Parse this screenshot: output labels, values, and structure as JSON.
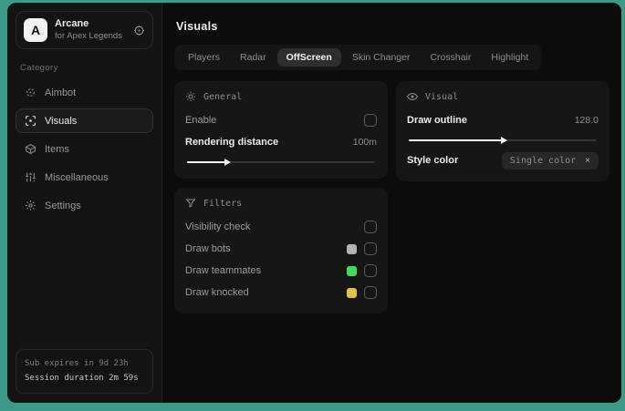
{
  "window": {
    "frame_color": "#3c9a88"
  },
  "sidebar": {
    "logo_letter": "A",
    "app_name": "Arcane",
    "app_subtitle": "for Apex Legends",
    "category_label": "Category",
    "items": [
      {
        "label": "Aimbot",
        "icon": "crosshair-icon",
        "selected": false
      },
      {
        "label": "Visuals",
        "icon": "eye-scan-icon",
        "selected": true
      },
      {
        "label": "Items",
        "icon": "box-icon",
        "selected": false
      },
      {
        "label": "Miscellaneous",
        "icon": "sliders-icon",
        "selected": false
      },
      {
        "label": "Settings",
        "icon": "gear-icon",
        "selected": false
      }
    ],
    "footer": {
      "sub_expires": "Sub expires in 9d 23h",
      "session_duration": "Session duration 2m 59s"
    }
  },
  "main": {
    "title": "Visuals",
    "tabs": [
      {
        "label": "Players",
        "active": false
      },
      {
        "label": "Radar",
        "active": false
      },
      {
        "label": "OffScreen",
        "active": true
      },
      {
        "label": "Skin Changer",
        "active": false
      },
      {
        "label": "Crosshair",
        "active": false
      },
      {
        "label": "Highlight",
        "active": false
      }
    ],
    "panels": {
      "general": {
        "title": "General",
        "icon": "sun-gear-icon",
        "enable_label": "Enable",
        "enable_checked": false,
        "rendering_label": "Rendering distance",
        "rendering_value": "100m",
        "rendering_percent": "21%"
      },
      "visual": {
        "title": "Visual",
        "icon": "eye-icon",
        "outline_label": "Draw outline",
        "outline_value": "128.0",
        "outline_percent": "50%",
        "style_label": "Style color",
        "style_chip": "Single color",
        "style_chip_close": "×"
      },
      "filters": {
        "title": "Filters",
        "icon": "funnel-icon",
        "rows": [
          {
            "label": "Visibility check",
            "swatch": null,
            "checked": false
          },
          {
            "label": "Draw bots",
            "swatch": "#b3b3b3",
            "checked": false
          },
          {
            "label": "Draw teammates",
            "swatch": "#46d95f",
            "checked": false
          },
          {
            "label": "Draw knocked",
            "swatch": "#e0c048",
            "checked": false
          }
        ]
      }
    }
  }
}
